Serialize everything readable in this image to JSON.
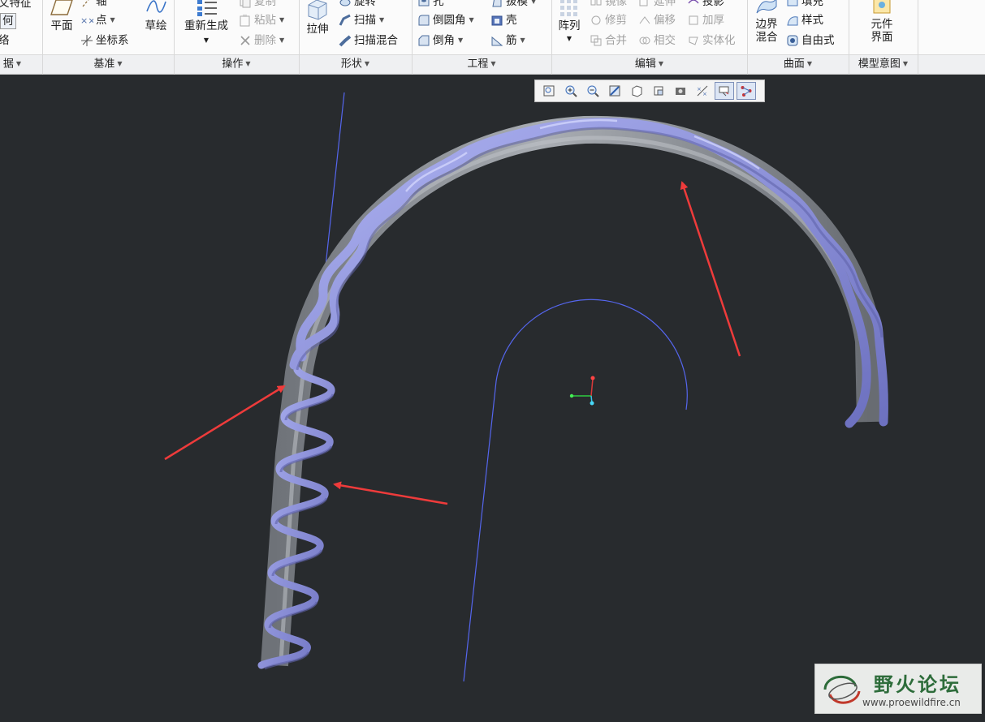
{
  "ribbon": {
    "partial_left": {
      "line1": "文特征",
      "line2": "何",
      "line3": "络"
    },
    "datum": {
      "plane": "平面",
      "axis": "轴",
      "point": "点",
      "csys": "坐标系",
      "sketch": "草绘"
    },
    "operations": {
      "regenerate": "重新生成",
      "copy": "复制",
      "paste": "粘贴",
      "delete": "删除"
    },
    "shapes": {
      "extrude": "拉伸",
      "revolve": "旋转",
      "sweep": "扫描",
      "swept_blend": "扫描混合"
    },
    "engineering": {
      "hole": "孔",
      "round": "倒圆角",
      "chamfer": "倒角",
      "draft": "拔模",
      "shell": "壳",
      "rib": "筋"
    },
    "editing": {
      "pattern": "阵列",
      "mirror": "镜像",
      "trim": "修剪",
      "merge": "合并",
      "extend": "延伸",
      "offset": "偏移",
      "intersect": "相交",
      "project": "投影",
      "thicken": "加厚",
      "solidify": "实体化"
    },
    "surfaces": {
      "boundary_blend_1": "边界",
      "boundary_blend_2": "混合",
      "fill": "填充",
      "style": "样式",
      "freestyle": "自由式"
    },
    "model_intent": {
      "component_1": "元件",
      "component_2": "界面"
    },
    "groups": {
      "data_partial": "据",
      "datum": "基准",
      "operations": "操作",
      "shapes": "形状",
      "engineering": "工程",
      "editing": "编辑",
      "surfaces": "曲面",
      "model_intent": "模型意图"
    }
  },
  "view_toolbar": {
    "buttons": [
      "refit-icon",
      "zoom-in-icon",
      "zoom-out-icon",
      "repaint-icon",
      "display-style-icon",
      "saved-views-icon",
      "view-manager-icon",
      "datum-display-icon",
      "spin-center-icon",
      "annotation-display-icon"
    ],
    "active": [
      "spin-center-icon",
      "annotation-display-icon"
    ]
  },
  "colors": {
    "viewport_bg": "#282b2e",
    "model_core": "#8d9198",
    "model_wire": "#8c90d4",
    "datum_curve": "#5566ee",
    "annotation_arrow": "#ee3b3b"
  },
  "watermark": {
    "title": "野火论坛",
    "url": "www.proewildfire.cn"
  }
}
